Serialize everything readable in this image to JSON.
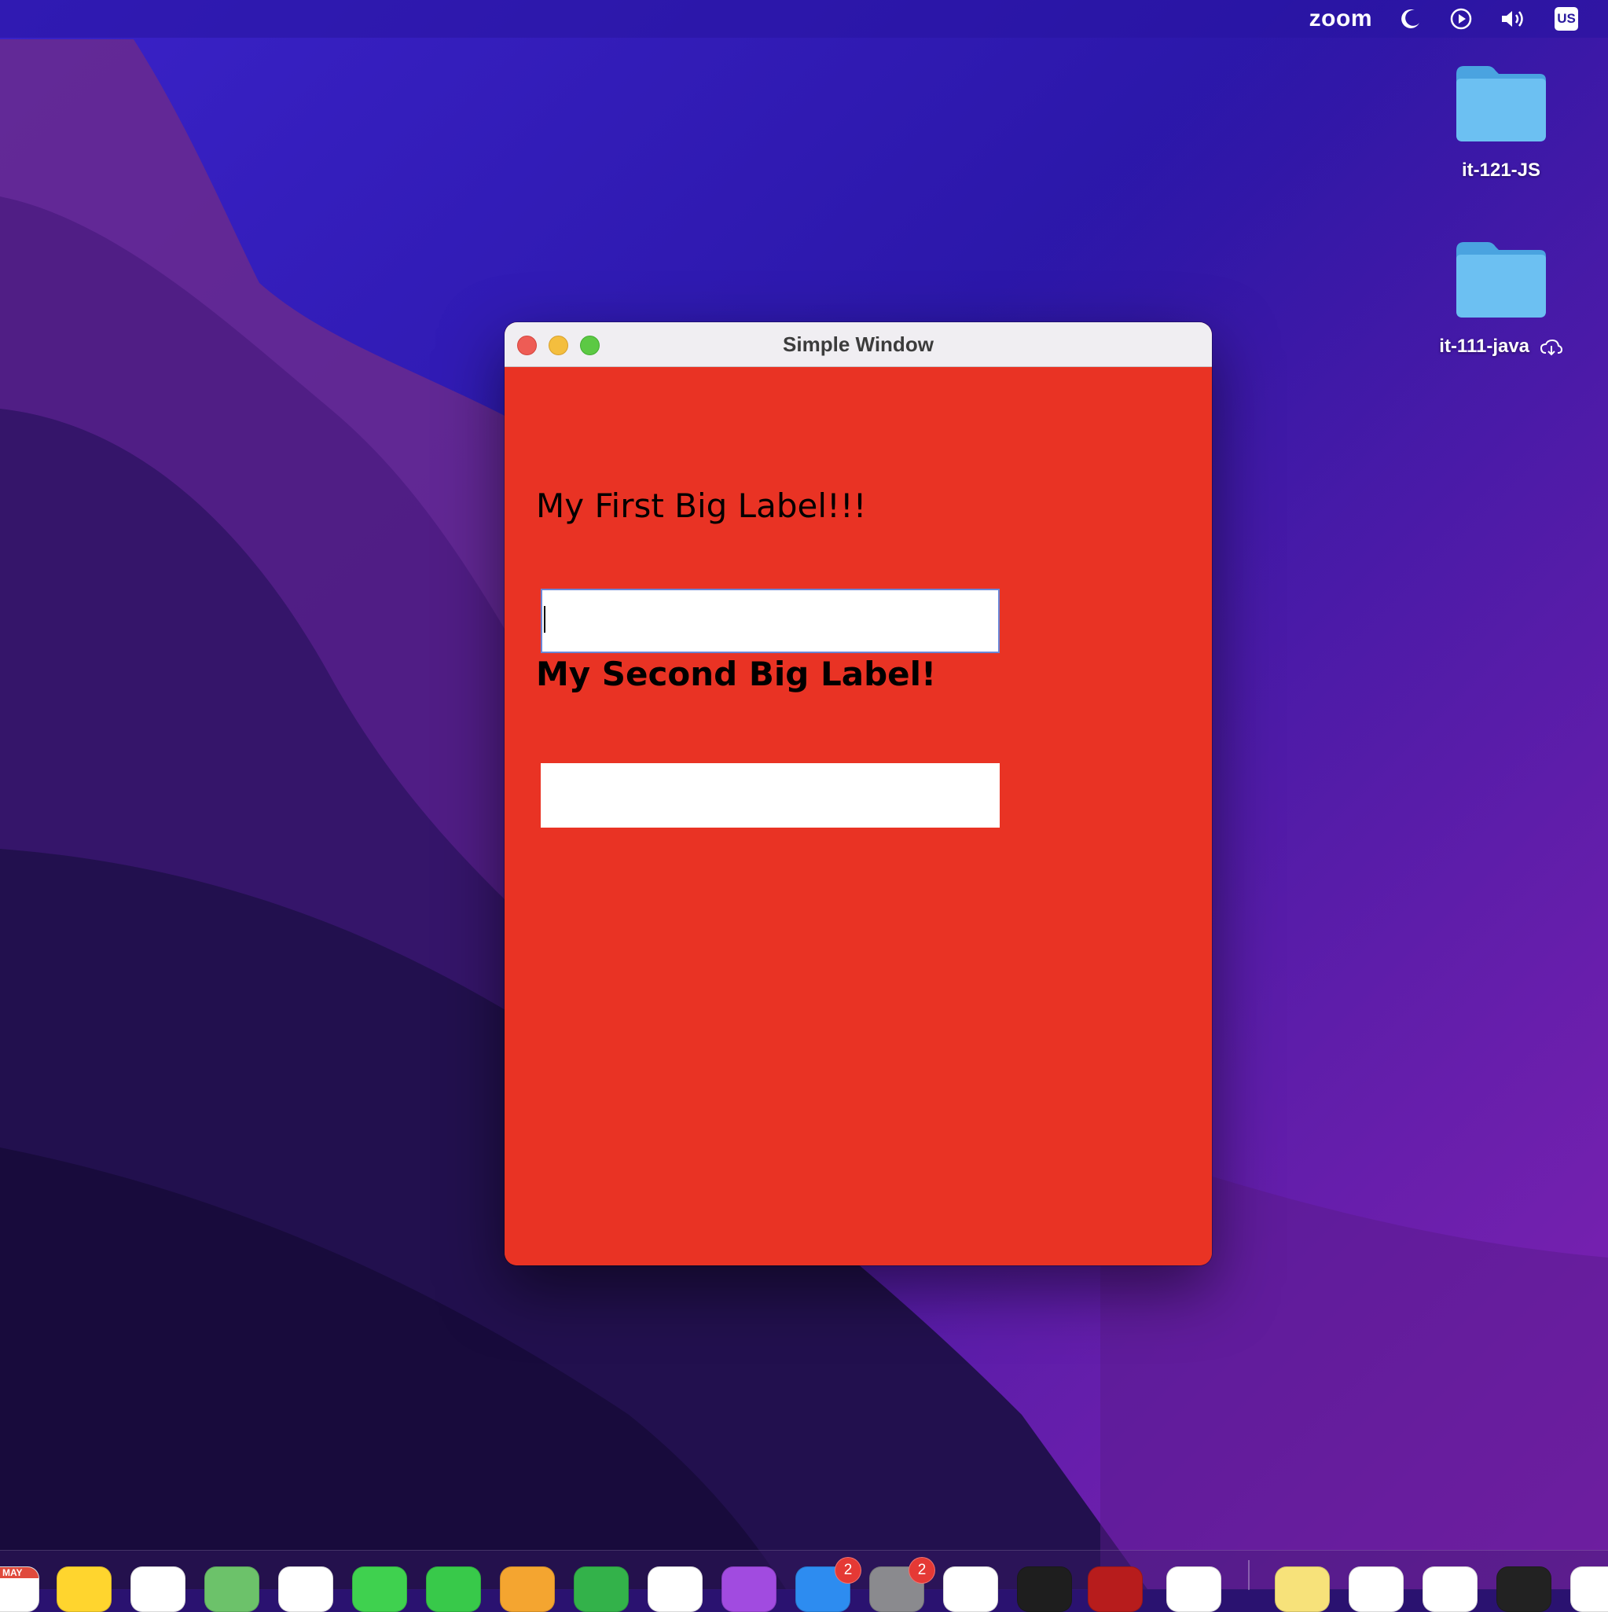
{
  "menubar": {
    "zoom_label": "zoom",
    "keyboard_layout": "US",
    "icons": [
      "moon-icon",
      "play-circle-icon",
      "volume-icon"
    ]
  },
  "desktop": {
    "folders": [
      {
        "label": "it-121-JS",
        "icon": "folder-icon"
      },
      {
        "label": "it-111-java",
        "icon": "folder-icon",
        "status_icon": "cloud-download-icon"
      }
    ]
  },
  "window": {
    "title": "Simple Window",
    "background_color": "#e93324",
    "label_1": "My First Big Label!!!",
    "field_1_value": "",
    "label_2": "My Second Big Label!",
    "field_2_value": ""
  },
  "dock": {
    "calendar_month": "MAY",
    "apps": [
      {
        "name": "calendar",
        "color": "#ffffff"
      },
      {
        "name": "notes",
        "color": "#ffd52e"
      },
      {
        "name": "reminders",
        "color": "#ffffff"
      },
      {
        "name": "maps",
        "color": "#6cc26a"
      },
      {
        "name": "photos",
        "color": "#ffffff"
      },
      {
        "name": "messages",
        "color": "#3fd14f"
      },
      {
        "name": "facetime",
        "color": "#38c94a"
      },
      {
        "name": "pages",
        "color": "#f4a530"
      },
      {
        "name": "numbers",
        "color": "#33b24a"
      },
      {
        "name": "news",
        "color": "#ffffff"
      },
      {
        "name": "podcasts",
        "color": "#a14be0"
      },
      {
        "name": "app-store",
        "color": "#2d8cf0",
        "badge": "2"
      },
      {
        "name": "system-preferences",
        "color": "#8a8a8e",
        "badge": "2"
      },
      {
        "name": "chrome",
        "color": "#ffffff"
      },
      {
        "name": "terminal",
        "color": "#1e1e1e"
      },
      {
        "name": "filezilla",
        "color": "#b71c1c"
      },
      {
        "name": "vscode",
        "color": "#ffffff"
      },
      {
        "name": "stickies",
        "color": "#f7e27a"
      },
      {
        "name": "word",
        "color": "#ffffff"
      },
      {
        "name": "powerpoint",
        "color": "#ffffff"
      },
      {
        "name": "intellij",
        "color": "#222222"
      },
      {
        "name": "tasks",
        "color": "#ffffff"
      }
    ]
  }
}
